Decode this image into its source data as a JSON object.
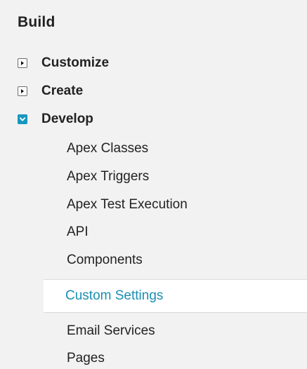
{
  "section": {
    "title": "Build"
  },
  "tree": [
    {
      "label": "Customize",
      "state": "collapsed",
      "icon": "triangle-right-icon"
    },
    {
      "label": "Create",
      "state": "collapsed",
      "icon": "triangle-right-icon"
    },
    {
      "label": "Develop",
      "state": "expanded",
      "icon": "chevron-down-icon"
    }
  ],
  "develop_children": [
    "Apex Classes",
    "Apex Triggers",
    "Apex Test Execution",
    "API",
    "Components",
    "Custom Settings",
    "Email Services",
    "Pages"
  ],
  "selected": "Custom Settings",
  "colors": {
    "background": "#f2f2f2",
    "selected_background": "#ffffff",
    "selected_text": "#1a8fb3",
    "expanded_toggle": "#1797c0",
    "text": "#222222"
  }
}
